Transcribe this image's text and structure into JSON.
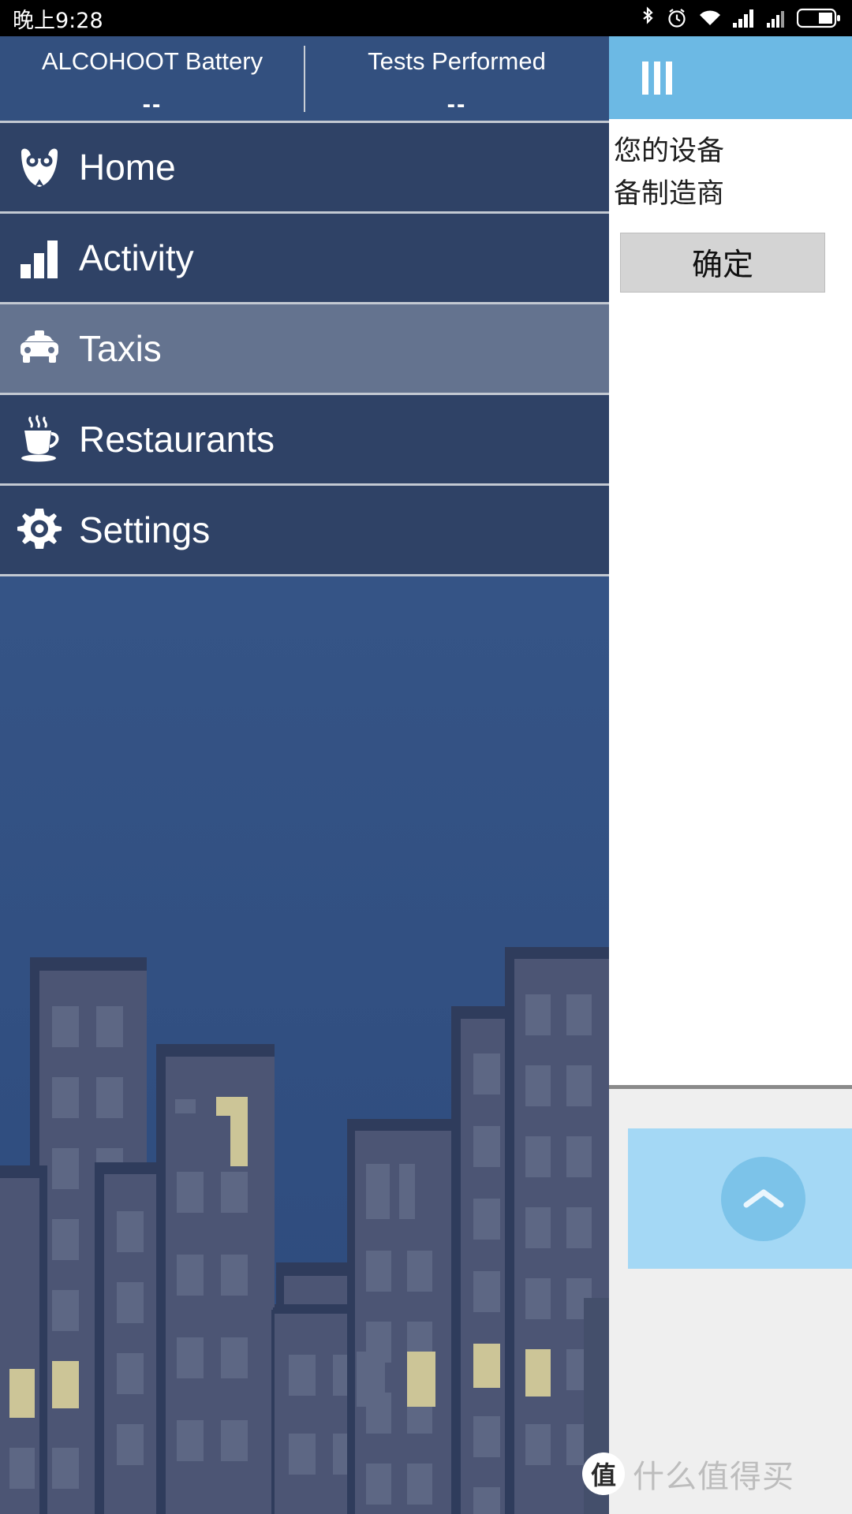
{
  "status_bar": {
    "time": "晚上9:28",
    "icons": [
      "bluetooth-icon",
      "alarm-icon",
      "wifi-icon",
      "signal-icon-1",
      "signal-icon-2",
      "battery-icon"
    ]
  },
  "stats": {
    "items": [
      {
        "label": "ALCOHOOT Battery",
        "value": "--"
      },
      {
        "label": "Tests Performed",
        "value": "--"
      }
    ]
  },
  "nav": {
    "items": [
      {
        "label": "Home",
        "icon": "owl-icon",
        "active": false
      },
      {
        "label": "Activity",
        "icon": "bar-chart-icon",
        "active": false
      },
      {
        "label": "Taxis",
        "icon": "taxi-icon",
        "active": true
      },
      {
        "label": "Restaurants",
        "icon": "coffee-cup-icon",
        "active": false
      },
      {
        "label": "Settings",
        "icon": "gear-icon",
        "active": false
      }
    ]
  },
  "dialog": {
    "title_icon": "menu-bars-icon",
    "message": "您的设备",
    "message_line2": "备制造商",
    "confirm_label": "确定"
  },
  "bottom_panel": {
    "scroll_top_icon": "chevron-up-icon"
  },
  "watermark": {
    "badge": "值",
    "text": "什么值得买"
  },
  "colors": {
    "app_background": "#2f4266",
    "stats_background": "#33507f",
    "nav_active": "#64738f",
    "divider": "#c3c9d2",
    "dialog_titlebar": "#6cb9e4",
    "sky": "#3a5a8c",
    "building_roof": "#2f3c5c",
    "building_body": "#4c5574",
    "window": "#5d6784",
    "window_lit": "#ccc597",
    "scroll_btn": "#7cc3e9",
    "panel_blue": "#a4d8f5"
  }
}
